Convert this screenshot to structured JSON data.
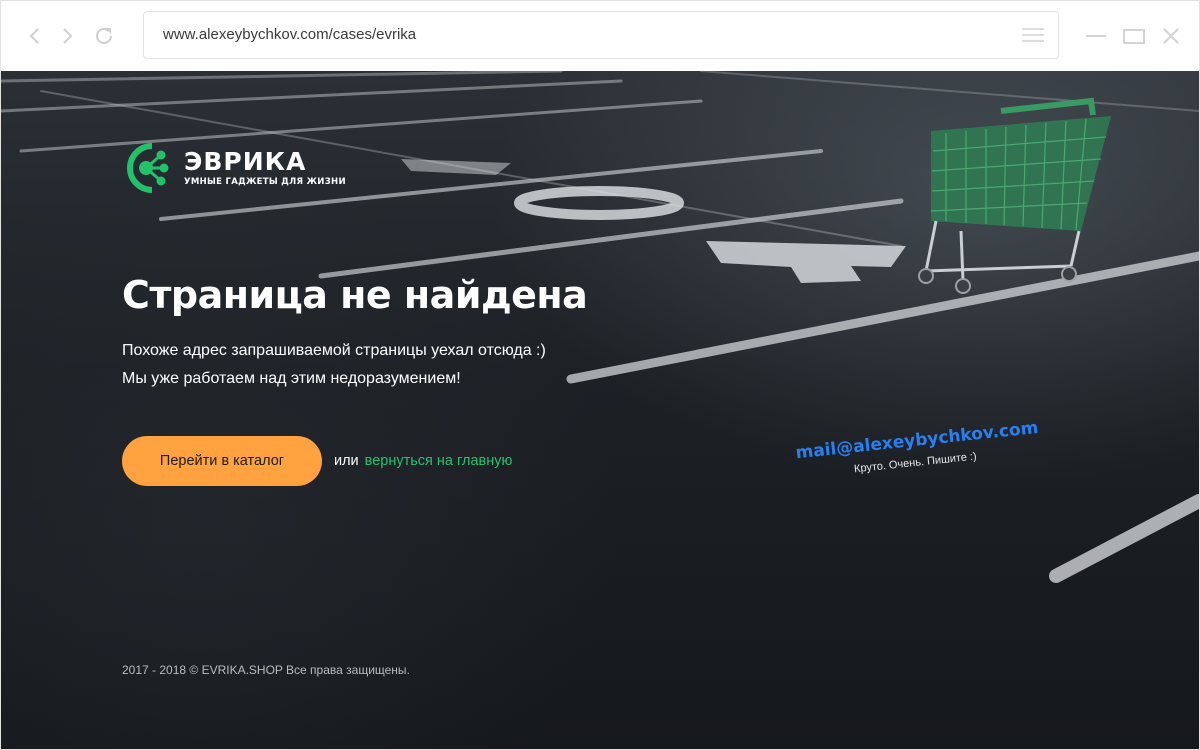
{
  "browser": {
    "url": "www.alexeybychkov.com/cases/evrika",
    "icons": {
      "back": "chevron-left-icon",
      "forward": "chevron-right-icon",
      "reload": "reload-icon",
      "menu": "hamburger-menu-icon",
      "minimize": "minimize-icon",
      "maximize": "maximize-icon",
      "close": "close-icon"
    }
  },
  "logo": {
    "name": "ЭВРИКА",
    "tagline": "УМНЫЕ ГАДЖЕТЫ ДЛЯ ЖИЗНИ",
    "icon": "molecule-logo-icon"
  },
  "main": {
    "title": "Страница не найдена",
    "description_lines": [
      "Похоже адрес запрашиваемой страницы уехал отсюда :)",
      "Мы уже работаем над этим недоразумением!"
    ],
    "catalog_button": "Перейти в каталог",
    "or_text": "или",
    "home_link": "вернуться на главную"
  },
  "contact": {
    "email": "mail@alexeybychkov.com",
    "note": "Круто. Очень. Пишите :)"
  },
  "footer": {
    "copyright": "2017 - 2018 © EVRIKA.SHOP Все права защищены."
  },
  "colors": {
    "accent_orange": "#ffa23f",
    "link_green": "#27c26c",
    "email_blue": "#2a7ff0",
    "logo_green": "#22c26a"
  }
}
